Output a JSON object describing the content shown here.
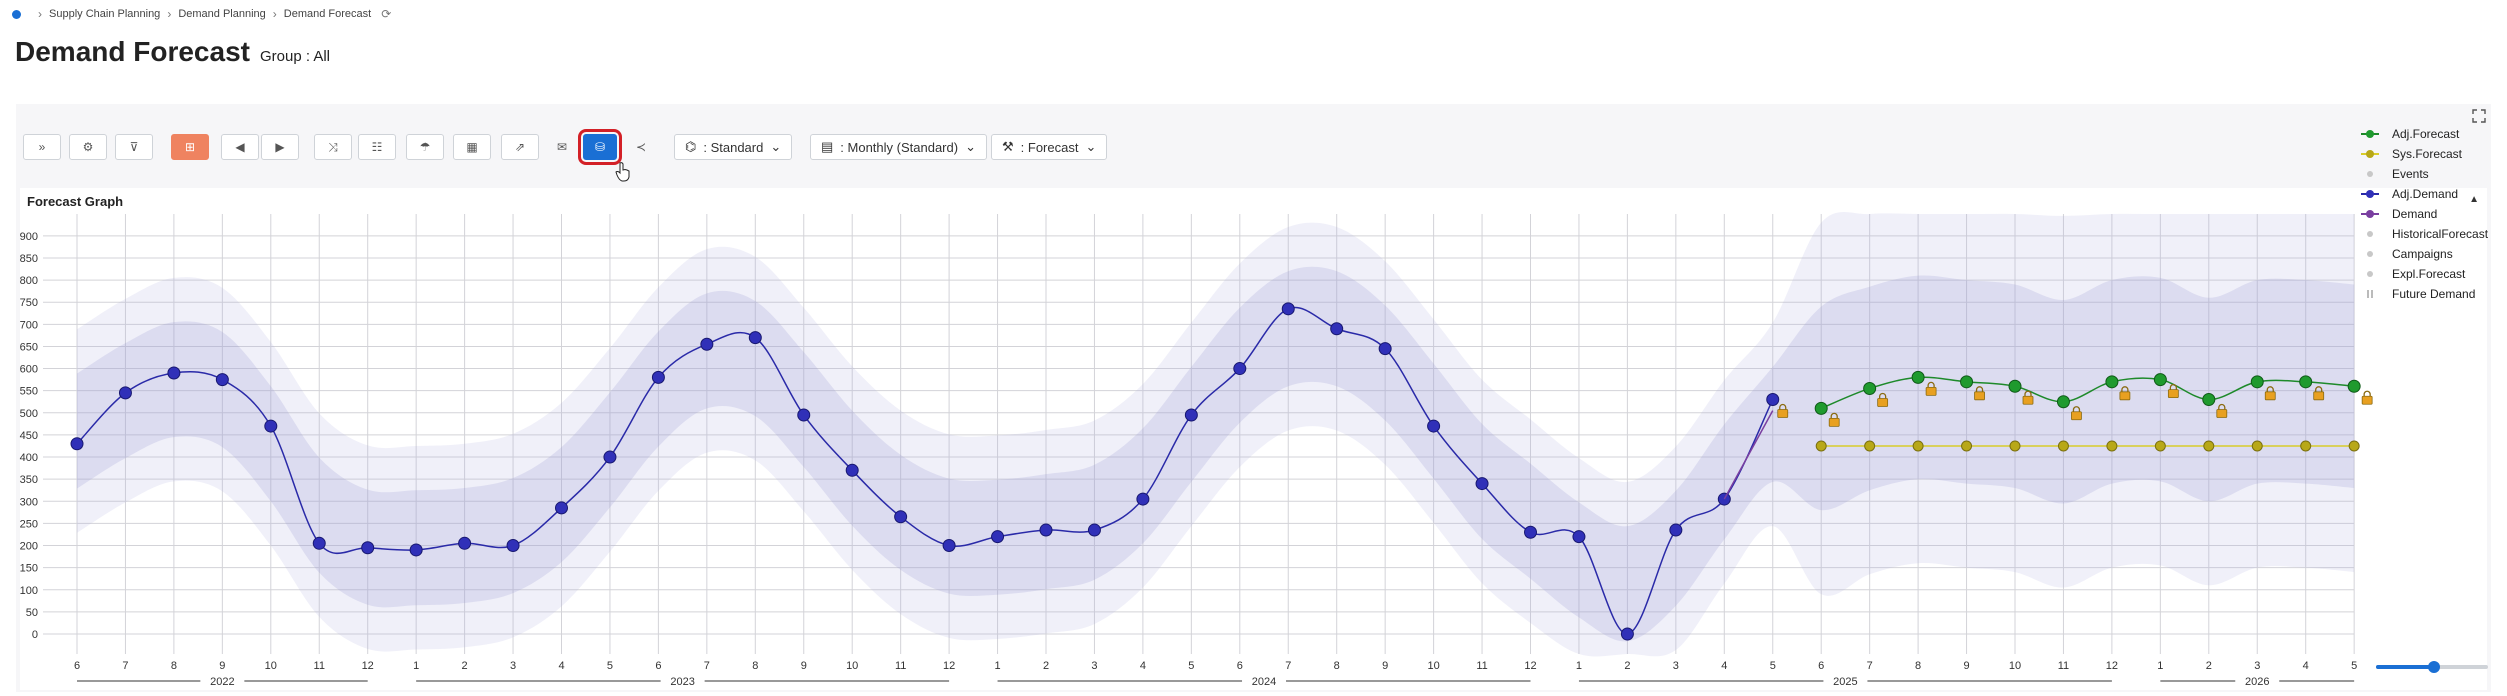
{
  "breadcrumb": [
    "Supply Chain Planning",
    "Demand Planning",
    "Demand Forecast"
  ],
  "header": {
    "title": "Demand Forecast",
    "group": "Group : All"
  },
  "toolbar": {
    "view": ": Standard",
    "period": ": Monthly (Standard)",
    "measure": ": Forecast"
  },
  "graph": {
    "title": "Forecast Graph"
  },
  "colors": {
    "accent": "#1a6fd4",
    "orange": "#ef8360",
    "selected_outline": "#d32027"
  },
  "chart_data": {
    "type": "line",
    "title": "Forecast Graph",
    "ylim": [
      0,
      950
    ],
    "yticks": [
      0,
      50,
      100,
      150,
      200,
      250,
      300,
      350,
      400,
      450,
      500,
      550,
      600,
      650,
      700,
      750,
      800,
      850,
      900
    ],
    "grid": true,
    "legend_position": "right",
    "x": [
      6,
      7,
      8,
      9,
      10,
      11,
      12,
      1,
      2,
      3,
      4,
      5,
      6,
      7,
      8,
      9,
      10,
      11,
      12,
      1,
      2,
      3,
      4,
      5,
      6,
      7,
      8,
      9,
      10,
      11,
      12,
      1,
      2,
      3,
      4,
      5,
      6,
      7,
      8,
      9,
      10,
      11,
      12,
      1,
      2,
      3,
      4,
      5
    ],
    "years": [
      {
        "label": "2022",
        "start": 0,
        "end": 6
      },
      {
        "label": "2023",
        "start": 7,
        "end": 18
      },
      {
        "label": "2024",
        "start": 19,
        "end": 30
      },
      {
        "label": "2025",
        "start": 31,
        "end": 42
      },
      {
        "label": "2026",
        "start": 43,
        "end": 47
      }
    ],
    "series": [
      {
        "name": "Adj.Demand",
        "color": "#2a2aa8",
        "start": 0,
        "values": [
          430,
          545,
          590,
          575,
          470,
          205,
          195,
          190,
          205,
          200,
          285,
          400,
          580,
          655,
          670,
          495,
          370,
          265,
          200,
          220,
          235,
          235,
          305,
          495,
          600,
          735,
          690,
          645,
          470,
          340,
          230,
          220,
          0,
          235,
          305,
          530
        ]
      },
      {
        "name": "Demand",
        "color": "#7a3fa0",
        "start": 34,
        "values": [
          305,
          505
        ]
      },
      {
        "name": "Adj.Forecast",
        "color": "#1e8a2a",
        "start": 36,
        "values": [
          510,
          555,
          580,
          570,
          560,
          525,
          570,
          575,
          530,
          570,
          570,
          560
        ]
      },
      {
        "name": "Sys.Forecast",
        "color": "#d8cc2a",
        "start": 36,
        "values": [
          425,
          425,
          425,
          425,
          425,
          425,
          425,
          425,
          425,
          425,
          425,
          425
        ]
      }
    ],
    "legend": [
      "Adj.Forecast",
      "Sys.Forecast",
      "Events",
      "Adj.Demand",
      "Demand",
      "HistoricalForecast",
      "Campaigns",
      "Expl.Forecast",
      "Future Demand"
    ]
  }
}
